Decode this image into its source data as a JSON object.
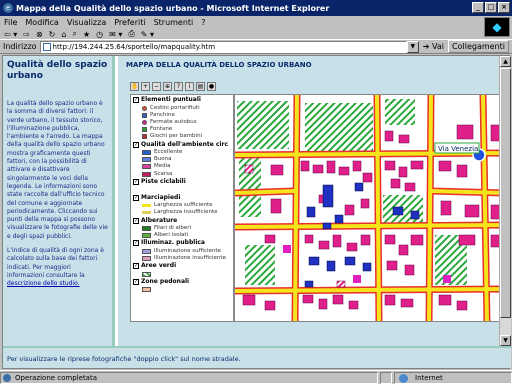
{
  "window": {
    "title": "Mappa della Qualità dello spazio urbano - Microsoft Internet Explorer"
  },
  "menu": [
    "File",
    "Modifica",
    "Visualizza",
    "Preferiti",
    "Strumenti",
    "?"
  ],
  "toolbar": [
    "Indietro",
    "Avanti",
    "Termina",
    "Aggiorna",
    "Pagina iniziale",
    "Cerca",
    "Preferiti",
    "Cronologia",
    "Posta",
    "Stampa"
  ],
  "address": {
    "label": "Indirizzo",
    "value": "http://194.244.25.64/sportello/mapquality.htm",
    "go": "Vai",
    "links": "Collegamenti"
  },
  "left": {
    "title": "Qualità dello spazio urbano",
    "p1": "La qualità dello spazio urbano è la somma di diversi fattori: il verde urbano, il tessuto storico, l'illuminazione pubblica, l'ambiente e l'arredo. La mappa della qualità dello spazio urbano mostra graficamente questi fattori, con la possibilità di attivare e disattivare singolarmente le voci della legenda. Le informazioni sono state raccolte dall'ufficio tecnico del comune e aggiornate periodicamente. Cliccando sui punti della mappa si possono visualizzare le fotografie delle vie e degli spazi pubblici.",
    "p2": "L'indice di qualità di ogni zona è calcolato sulla base dei fattori indicati. Per maggiori informazioni consultare la",
    "link": "descrizione dello studio."
  },
  "map": {
    "title": "MAPPA DELLA QUALITÀ DELLO SPAZIO URBANO",
    "tools": [
      "pan",
      "zoom-in",
      "zoom-out",
      "zoom-full",
      "identify",
      "info",
      "print",
      "help"
    ],
    "label": "Via Venezia",
    "legend": [
      {
        "group": "Elementi puntuali",
        "items": [
          "Cestini portarifiuti",
          "Panchine",
          "Fermate autobus",
          "Fontane",
          "Giochi per bambini"
        ]
      },
      {
        "group": "Qualità dell'ambiente circ",
        "items": [
          "Eccellente",
          "Buona",
          "Media",
          "Scarsa"
        ]
      },
      {
        "group": "Piste ciclabili",
        "items": []
      },
      {
        "group": "Marciapiedi",
        "items": [
          "Larghezza sufficiente",
          "Larghezza insufficiente"
        ]
      },
      {
        "group": "Alberature",
        "items": [
          "Filari di alberi",
          "Alberi isolati"
        ]
      },
      {
        "group": "Illuminaz. pubblica",
        "items": [
          "Illuminazione sufficiente",
          "Illuminazione insufficiente"
        ]
      },
      {
        "group": "Aree verdi",
        "items": []
      },
      {
        "group": "Zone pedonali",
        "items": []
      }
    ]
  },
  "hint": "Per visualizzare le riprese fotografiche \"doppio click\" sul nome stradale.",
  "status": {
    "left": "Operazione completata",
    "zone": "Internet"
  },
  "colors": {
    "road": "#f4e41c",
    "boundary": "#e8302a",
    "green": "#2aa83a",
    "building": "#e0208a",
    "building_blue": "#2030c0"
  }
}
